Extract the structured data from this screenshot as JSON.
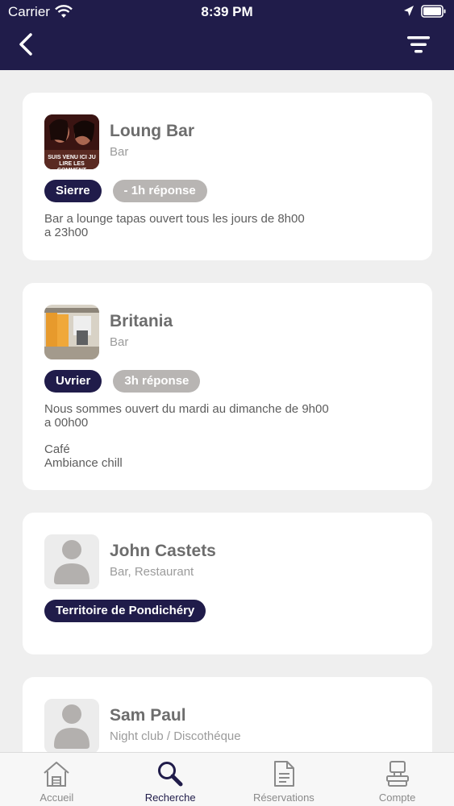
{
  "status_bar": {
    "carrier": "Carrier",
    "time": "8:39 PM"
  },
  "header": {
    "back_icon": "chevron-left-icon",
    "filter_icon": "filter-icon"
  },
  "colors": {
    "primary": "#201c4a",
    "tag_grey": "#b8b5b3",
    "background": "#efefef"
  },
  "results": [
    {
      "name": "Loung Bar",
      "category": "Bar",
      "location_tag": "Sierre",
      "response_tag": "- 1h réponse",
      "description": "Bar a lounge tapas ouvert tous les jours de 8h00\na 23h00",
      "image_caption": "SUIS VENU ICI JU\nLIRE LES COMMENT"
    },
    {
      "name": "Britania",
      "category": "Bar",
      "location_tag": "Uvrier",
      "response_tag": "3h réponse",
      "description": "Nous sommes ouvert du mardi au dimanche de 9h00\na 00h00",
      "extra": "Café\nAmbiance chill"
    },
    {
      "name": "John Castets",
      "category": "Bar, Restaurant",
      "location_tag": "Territoire de Pondichéry"
    },
    {
      "name": "Sam Paul",
      "category": "Night club / Discothéque"
    }
  ],
  "tabbar": {
    "items": [
      {
        "label": "Accueil",
        "icon": "home-icon"
      },
      {
        "label": "Recherche",
        "icon": "search-icon"
      },
      {
        "label": "Réservations",
        "icon": "document-icon"
      },
      {
        "label": "Compte",
        "icon": "account-icon"
      }
    ],
    "active": "Recherche"
  }
}
